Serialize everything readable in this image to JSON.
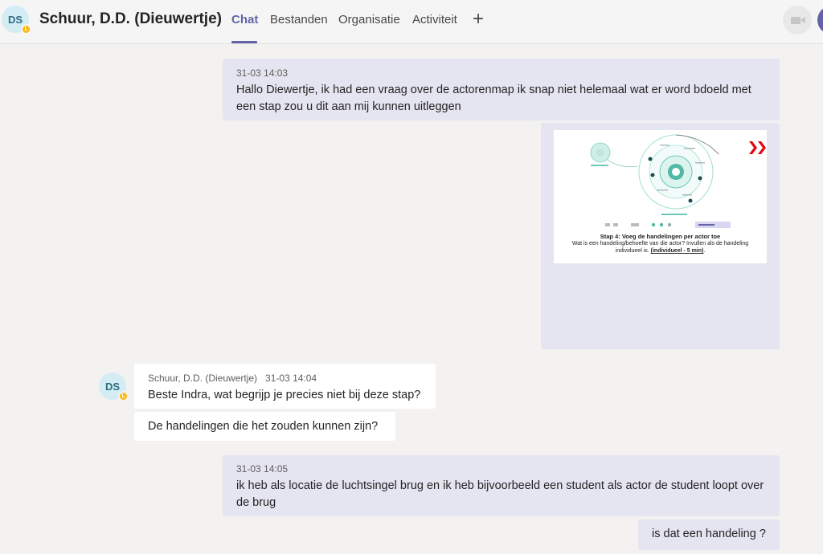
{
  "header": {
    "avatar_initials": "DS",
    "title": "Schuur, D.D. (Dieuwertje)",
    "tabs": [
      "Chat",
      "Bestanden",
      "Organisatie",
      "Activiteit"
    ],
    "active_tab": "Chat",
    "add_tab_icon": "plus-icon",
    "video_icon": "video-camera-icon",
    "accent_color": "#6264a7",
    "status_color": "#fdb913"
  },
  "messages": [
    {
      "from": "me",
      "timestamp": "31-03 14:03",
      "text": "Hallo Diewertje, ik had een vraag over de actorenmap ik snap niet helemaal wat er word bdoeld met een stap zou u dit aan mij kunnen uitleggen"
    },
    {
      "from": "me",
      "attachment": {
        "type": "image",
        "caption_title": "Stap 4: Voeg de handelingen per actor toe",
        "caption_line1": "Wat is een handeling/behoefte van die actor? Invullen als de handeling",
        "caption_line2_prefix": "individueel is. ",
        "caption_line2_emph": "(individueel - 5 min)",
        "caption_line2_suffix": "."
      }
    },
    {
      "from": "them",
      "avatar_initials": "DS",
      "sender": "Schuur, D.D. (Dieuwertje)",
      "timestamp": "31-03 14:04",
      "text": "Beste Indra, wat begrijp je precies niet bij deze stap?"
    },
    {
      "from": "them",
      "text": "De handelingen die het zouden kunnen zijn?"
    },
    {
      "from": "me",
      "timestamp": "31-03 14:05",
      "text": "ik heb als locatie de luchtsingel brug en ik heb bijvoorbeeld een student als actor de student loopt over de brug"
    },
    {
      "from": "me",
      "text": "is dat een handeling ?"
    }
  ]
}
